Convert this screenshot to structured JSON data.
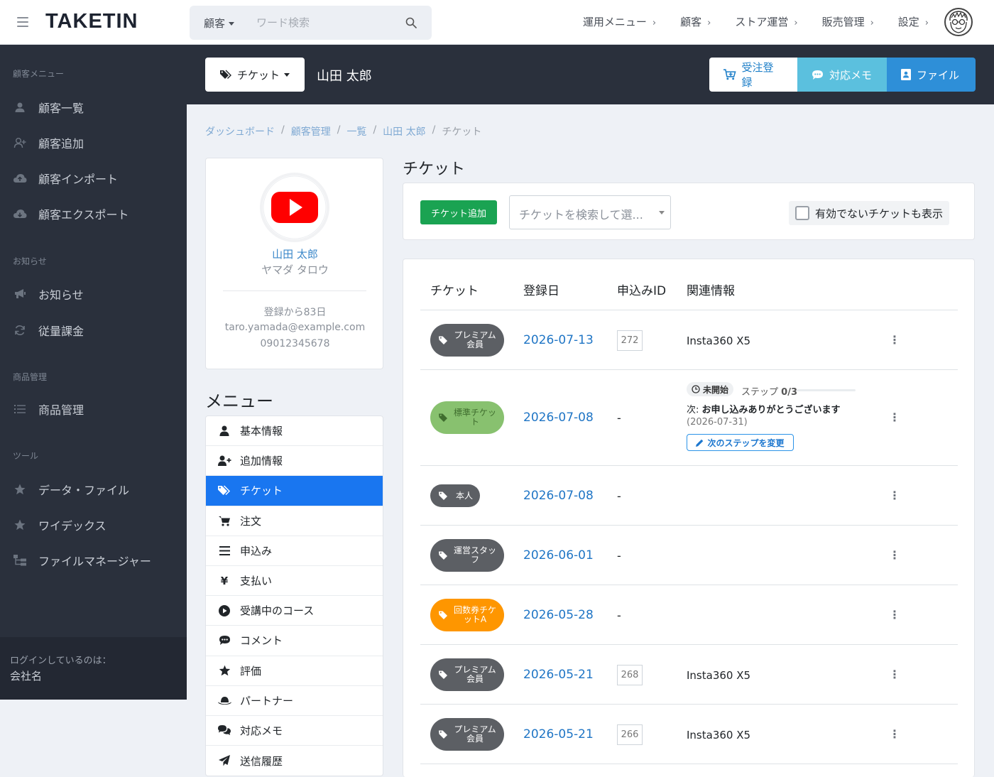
{
  "brand": {
    "logo": "TAKETIN"
  },
  "search": {
    "category": "顧客",
    "placeholder": "ワード検索"
  },
  "topnav": [
    {
      "label": "運用メニュー"
    },
    {
      "label": "顧客"
    },
    {
      "label": "ストア運営"
    },
    {
      "label": "販売管理"
    },
    {
      "label": "設定"
    }
  ],
  "sidebar": {
    "sections": [
      {
        "title": "顧客メニュー"
      },
      {
        "title": "お知らせ"
      },
      {
        "title": "商品管理"
      },
      {
        "title": "ツール"
      }
    ],
    "items": [
      {
        "label": "顧客一覧",
        "icon": "user-icon"
      },
      {
        "label": "顧客追加",
        "icon": "user-plus-icon"
      },
      {
        "label": "顧客インポート",
        "icon": "cloud-upload-icon"
      },
      {
        "label": "顧客エクスポート",
        "icon": "cloud-download-icon"
      },
      {
        "label": "お知らせ",
        "icon": "bullhorn-icon"
      },
      {
        "label": "従量課金",
        "icon": "refresh-icon"
      },
      {
        "label": "商品管理",
        "icon": "list-icon"
      },
      {
        "label": "データ・ファイル",
        "icon": "star-icon"
      },
      {
        "label": "ワイデックス",
        "icon": "star-icon"
      },
      {
        "label": "ファイルマネージャー",
        "icon": "sitemap-icon"
      }
    ],
    "footer": {
      "login_label": "ログインしているのは：",
      "company": "会社名"
    }
  },
  "header": {
    "dropdown_label": "チケット",
    "customer_name": "山田 太郎",
    "buttons": {
      "order": "受注登録",
      "memo": "対応メモ",
      "file": "ファイル"
    },
    "colors": {
      "band": "#2a303c",
      "memo": "#5bc0de",
      "file": "#2e8fd8"
    }
  },
  "breadcrumb": [
    "ダッシュボード",
    "顧客管理",
    "一覧",
    "山田 太郎",
    "チケット"
  ],
  "profile": {
    "name": "山田 太郎",
    "kana": "ヤマダ タロウ",
    "since": "登録から83日",
    "email": "taro.yamada@example.com",
    "phone": "09012345678",
    "avatar_icon": "youtube-icon"
  },
  "menu": {
    "title": "メニュー",
    "items": [
      {
        "label": "基本情報",
        "icon": "user-icon"
      },
      {
        "label": "追加情報",
        "icon": "user-plus-icon"
      },
      {
        "label": "チケット",
        "icon": "tags-icon",
        "active": true
      },
      {
        "label": "注文",
        "icon": "cart-icon"
      },
      {
        "label": "申込み",
        "icon": "bars-icon"
      },
      {
        "label": "支払い",
        "icon": "yen-icon"
      },
      {
        "label": "受講中のコース",
        "icon": "play-circle-icon"
      },
      {
        "label": "コメント",
        "icon": "comment-icon"
      },
      {
        "label": "評価",
        "icon": "star-icon"
      },
      {
        "label": "パートナー",
        "icon": "hat-icon"
      },
      {
        "label": "対応メモ",
        "icon": "comments-icon"
      },
      {
        "label": "送信履歴",
        "icon": "paper-plane-icon"
      }
    ]
  },
  "tickets": {
    "title": "チケット",
    "add_button": "チケット追加",
    "search_placeholder": "チケットを検索して選...",
    "show_inactive_label": "有効でないチケットも表示",
    "columns": [
      "チケット",
      "登録日",
      "申込みID",
      "関連情報"
    ],
    "rows": [
      {
        "ticket": "プレミアム会員",
        "date": "2026-07-13",
        "id": "272",
        "info": "Insta360 X5",
        "color": "#5c5f64"
      },
      {
        "ticket": "標準チケット",
        "date": "2026-07-08",
        "id": "-",
        "status": "未開始",
        "step_label": "ステップ",
        "step": "0/3",
        "next_label": "次:",
        "next": "お申し込みありがとうございます",
        "next_date": "(2026-07-31)",
        "next_button": "次のステップを変更",
        "color": "#88c16f"
      },
      {
        "ticket": "本人",
        "date": "2026-07-08",
        "id": "-",
        "color": "#5c5f64"
      },
      {
        "ticket": "運営スタッフ",
        "date": "2026-06-01",
        "id": "-",
        "color": "#5c5f64"
      },
      {
        "ticket": "回数券チケットA",
        "date": "2026-05-28",
        "id": "-",
        "color": "#fe9600"
      },
      {
        "ticket": "プレミアム会員",
        "date": "2026-05-21",
        "id": "268",
        "info": "Insta360 X5",
        "color": "#5c5f64"
      },
      {
        "ticket": "プレミアム会員",
        "date": "2026-05-21",
        "id": "266",
        "info": "Insta360 X5",
        "color": "#5c5f64"
      }
    ]
  }
}
